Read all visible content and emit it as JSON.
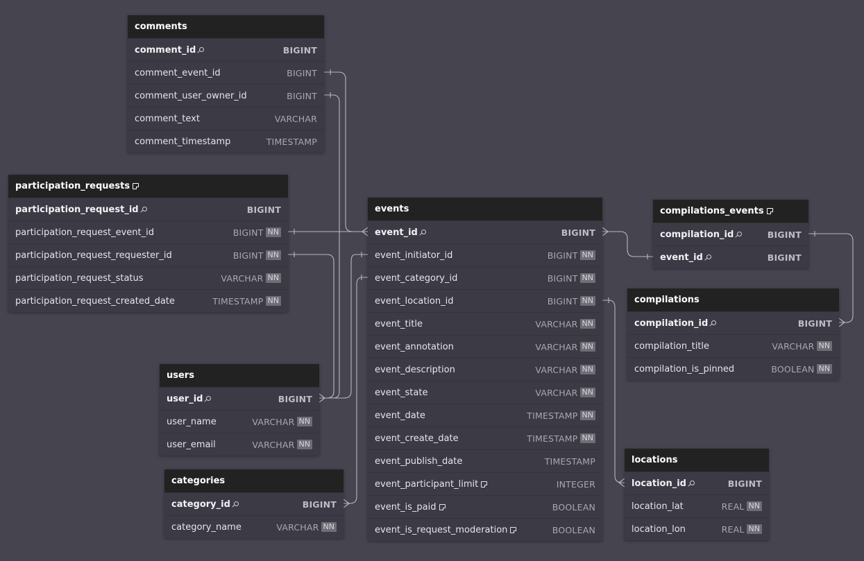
{
  "tables": {
    "comments": {
      "title": "comments",
      "columns": [
        {
          "name": "comment_id",
          "type": "BIGINT",
          "pk": true,
          "nn": false
        },
        {
          "name": "comment_event_id",
          "type": "BIGINT",
          "pk": false,
          "nn": false
        },
        {
          "name": "comment_user_owner_id",
          "type": "BIGINT",
          "pk": false,
          "nn": false
        },
        {
          "name": "comment_text",
          "type": "VARCHAR",
          "pk": false,
          "nn": false
        },
        {
          "name": "comment_timestamp",
          "type": "TIMESTAMP",
          "pk": false,
          "nn": false
        }
      ]
    },
    "participation_requests": {
      "title": "participation_requests",
      "has_note": true,
      "columns": [
        {
          "name": "participation_request_id",
          "type": "BIGINT",
          "pk": true,
          "nn": false
        },
        {
          "name": "participation_request_event_id",
          "type": "BIGINT",
          "pk": false,
          "nn": true
        },
        {
          "name": "participation_request_requester_id",
          "type": "BIGINT",
          "pk": false,
          "nn": true
        },
        {
          "name": "participation_request_status",
          "type": "VARCHAR",
          "pk": false,
          "nn": true
        },
        {
          "name": "participation_request_created_date",
          "type": "TIMESTAMP",
          "pk": false,
          "nn": true
        }
      ]
    },
    "events": {
      "title": "events",
      "columns": [
        {
          "name": "event_id",
          "type": "BIGINT",
          "pk": true,
          "nn": false
        },
        {
          "name": "event_initiator_id",
          "type": "BIGINT",
          "pk": false,
          "nn": true
        },
        {
          "name": "event_category_id",
          "type": "BIGINT",
          "pk": false,
          "nn": true
        },
        {
          "name": "event_location_id",
          "type": "BIGINT",
          "pk": false,
          "nn": true
        },
        {
          "name": "event_title",
          "type": "VARCHAR",
          "pk": false,
          "nn": true
        },
        {
          "name": "event_annotation",
          "type": "VARCHAR",
          "pk": false,
          "nn": true
        },
        {
          "name": "event_description",
          "type": "VARCHAR",
          "pk": false,
          "nn": true
        },
        {
          "name": "event_state",
          "type": "VARCHAR",
          "pk": false,
          "nn": true
        },
        {
          "name": "event_date",
          "type": "TIMESTAMP",
          "pk": false,
          "nn": true
        },
        {
          "name": "event_create_date",
          "type": "TIMESTAMP",
          "pk": false,
          "nn": true
        },
        {
          "name": "event_publish_date",
          "type": "TIMESTAMP",
          "pk": false,
          "nn": false
        },
        {
          "name": "event_participant_limit",
          "type": "INTEGER",
          "pk": false,
          "nn": false,
          "note": true
        },
        {
          "name": "event_is_paid",
          "type": "BOOLEAN",
          "pk": false,
          "nn": false,
          "note": true
        },
        {
          "name": "event_is_request_moderation",
          "type": "BOOLEAN",
          "pk": false,
          "nn": false,
          "note": true
        }
      ]
    },
    "compilations_events": {
      "title": "compilations_events",
      "has_note": true,
      "columns": [
        {
          "name": "compilation_id",
          "type": "BIGINT",
          "pk": true,
          "nn": false
        },
        {
          "name": "event_id",
          "type": "BIGINT",
          "pk": true,
          "nn": false
        }
      ]
    },
    "compilations": {
      "title": "compilations",
      "columns": [
        {
          "name": "compilation_id",
          "type": "BIGINT",
          "pk": true,
          "nn": false
        },
        {
          "name": "compilation_title",
          "type": "VARCHAR",
          "pk": false,
          "nn": true
        },
        {
          "name": "compilation_is_pinned",
          "type": "BOOLEAN",
          "pk": false,
          "nn": true
        }
      ]
    },
    "users": {
      "title": "users",
      "columns": [
        {
          "name": "user_id",
          "type": "BIGINT",
          "pk": true,
          "nn": false
        },
        {
          "name": "user_name",
          "type": "VARCHAR",
          "pk": false,
          "nn": true
        },
        {
          "name": "user_email",
          "type": "VARCHAR",
          "pk": false,
          "nn": true
        }
      ]
    },
    "categories": {
      "title": "categories",
      "columns": [
        {
          "name": "category_id",
          "type": "BIGINT",
          "pk": true,
          "nn": false
        },
        {
          "name": "category_name",
          "type": "VARCHAR",
          "pk": false,
          "nn": true
        }
      ]
    },
    "locations": {
      "title": "locations",
      "columns": [
        {
          "name": "location_id",
          "type": "BIGINT",
          "pk": true,
          "nn": false
        },
        {
          "name": "location_lat",
          "type": "REAL",
          "pk": false,
          "nn": true
        },
        {
          "name": "location_lon",
          "type": "REAL",
          "pk": false,
          "nn": true
        }
      ]
    }
  },
  "nn_label": "NN",
  "relations": [
    {
      "from": "comments.comment_event_id",
      "to": "events.event_id"
    },
    {
      "from": "participation_requests.participation_request_event_id",
      "to": "events.event_id"
    },
    {
      "from": "comments.comment_user_owner_id",
      "to": "users.user_id"
    },
    {
      "from": "participation_requests.participation_request_requester_id",
      "to": "users.user_id"
    },
    {
      "from": "events.event_initiator_id",
      "to": "users.user_id"
    },
    {
      "from": "events.event_category_id",
      "to": "categories.category_id"
    },
    {
      "from": "events.event_location_id",
      "to": "locations.location_id"
    },
    {
      "from": "compilations_events.event_id",
      "to": "events.event_id"
    },
    {
      "from": "compilations_events.compilation_id",
      "to": "compilations.compilation_id"
    }
  ]
}
